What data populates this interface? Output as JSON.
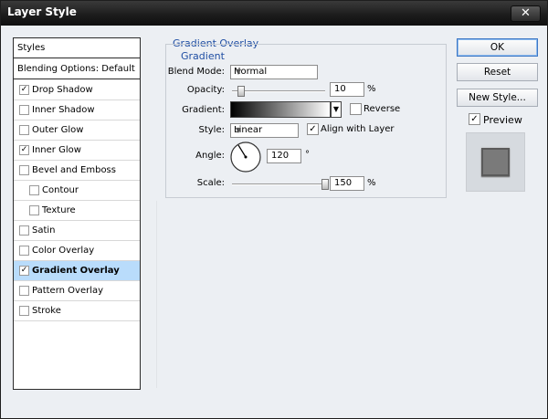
{
  "window": {
    "title": "Layer Style",
    "close_glyph": "✕"
  },
  "styles_panel": {
    "header": "Styles",
    "blending_options": "Blending Options: Default",
    "items": [
      {
        "label": "Drop Shadow",
        "checked": true,
        "indent": false,
        "selected": false
      },
      {
        "label": "Inner Shadow",
        "checked": false,
        "indent": false,
        "selected": false
      },
      {
        "label": "Outer Glow",
        "checked": false,
        "indent": false,
        "selected": false
      },
      {
        "label": "Inner Glow",
        "checked": true,
        "indent": false,
        "selected": false
      },
      {
        "label": "Bevel and Emboss",
        "checked": false,
        "indent": false,
        "selected": false
      },
      {
        "label": "Contour",
        "checked": false,
        "indent": true,
        "selected": false
      },
      {
        "label": "Texture",
        "checked": false,
        "indent": true,
        "selected": false
      },
      {
        "label": "Satin",
        "checked": false,
        "indent": false,
        "selected": false
      },
      {
        "label": "Color Overlay",
        "checked": false,
        "indent": false,
        "selected": false
      },
      {
        "label": "Gradient Overlay",
        "checked": true,
        "indent": false,
        "selected": true
      },
      {
        "label": "Pattern Overlay",
        "checked": false,
        "indent": false,
        "selected": false
      },
      {
        "label": "Stroke",
        "checked": false,
        "indent": false,
        "selected": false
      }
    ]
  },
  "gradient_overlay": {
    "section_title": "Gradient Overlay",
    "group_title": "Gradient",
    "blend_mode_label": "Blend Mode:",
    "blend_mode_value": "Normal",
    "opacity_label": "Opacity:",
    "opacity_value": "10",
    "opacity_unit": "%",
    "opacity_fraction": 0.1,
    "gradient_label": "Gradient:",
    "reverse_label": "Reverse",
    "reverse_checked": false,
    "style_label": "Style:",
    "style_value": "Linear",
    "align_label": "Align with Layer",
    "align_checked": true,
    "angle_label": "Angle:",
    "angle_value": "120",
    "angle_unit": "°",
    "scale_label": "Scale:",
    "scale_value": "150",
    "scale_unit": "%",
    "scale_fraction": 1.0
  },
  "buttons": {
    "ok": "OK",
    "reset": "Reset",
    "new_style": "New Style...",
    "preview_label": "Preview",
    "preview_checked": true
  },
  "colors": {
    "title_blue": "#1f4ea3",
    "selection": "#b9dcfb",
    "gradient_start": "#000000",
    "gradient_end": "#ffffff"
  }
}
